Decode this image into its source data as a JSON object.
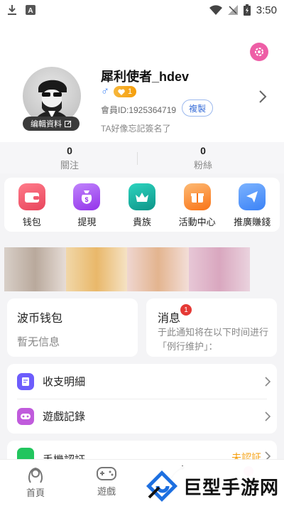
{
  "status_bar": {
    "time": "3:50",
    "icons": [
      "download-icon",
      "font-icon",
      "wifi-icon",
      "no-signal-icon",
      "battery-charging-icon"
    ]
  },
  "profile": {
    "username": "犀利使者_hdev",
    "gender_symbol": "♂",
    "level": "1",
    "member_id": "會員ID:1925364719",
    "copy_label": "複製",
    "edit_label": "编輯資料",
    "signature": "TA好像忘記簽名了",
    "accent_color": "#ee5ea6"
  },
  "stats": {
    "follow": {
      "value": "0",
      "label": "關注"
    },
    "fans": {
      "value": "0",
      "label": "粉絲"
    }
  },
  "menu": [
    {
      "label": "钱包",
      "icon": "wallet-icon",
      "color": "#f05a6e"
    },
    {
      "label": "提現",
      "icon": "money-bag-icon",
      "color": "#a855f7"
    },
    {
      "label": "貴族",
      "icon": "crown-icon",
      "color": "#14b8a6"
    },
    {
      "label": "活動中心",
      "icon": "gift-icon",
      "color": "#f97316"
    },
    {
      "label": "推廣賺錢",
      "icon": "paper-plane-icon",
      "color": "#3b82f6"
    }
  ],
  "wallet": {
    "title": "波币钱包",
    "subtitle": "暫无信息"
  },
  "notice": {
    "title": "消息",
    "badge": "1",
    "body": "于此通知将在以下时间进行「例行维护」："
  },
  "list": [
    {
      "label": "收支明細",
      "icon": "document-icon",
      "color": "#6d5dfc"
    },
    {
      "label": "遊戲記錄",
      "icon": "gamepad-icon",
      "color": "#a855f7"
    }
  ],
  "phone_row": {
    "label": "手機認証",
    "status": "未認証"
  },
  "tabs": [
    {
      "label": "首頁",
      "icon": "home-avatar-icon"
    },
    {
      "label": "遊戲",
      "icon": "gamepad-icon"
    },
    {
      "label": "",
      "icon": "sparkle-icon"
    },
    {
      "label": "",
      "icon": "profile-icon"
    }
  ],
  "watermark": "巨型手游网"
}
